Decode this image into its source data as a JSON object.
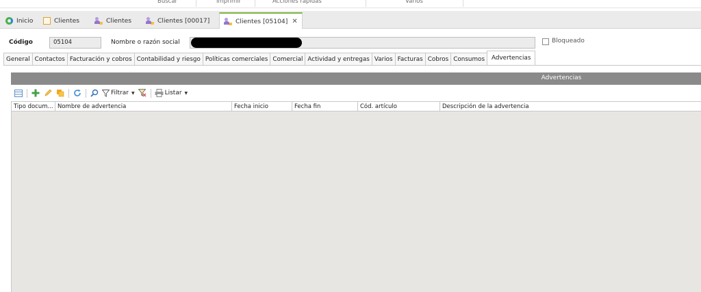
{
  "ribbon": {
    "groups": [
      "Buscar",
      "Imprimir",
      "Acciones rápidas",
      "Varios"
    ]
  },
  "doc_tabs": [
    {
      "label": "Inicio",
      "icon": "home-icon"
    },
    {
      "label": "Clientes",
      "icon": "document-icon"
    },
    {
      "label": "Clientes",
      "icon": "user-icon"
    },
    {
      "label": "Clientes [00017]",
      "icon": "user-icon"
    },
    {
      "label": "Clientes [05104]",
      "icon": "user-icon",
      "active": true,
      "closable": true
    }
  ],
  "header": {
    "codigo_label": "Código",
    "codigo_value": "05104",
    "nombre_label": "Nombre o razón social",
    "nombre_value": "",
    "bloqueado_label": "Bloqueado",
    "bloqueado_checked": false
  },
  "section_tabs": [
    "General",
    "Contactos",
    "Facturación y cobros",
    "Contabilidad y riesgo",
    "Políticas comerciales",
    "Comercial",
    "Actividad y entregas",
    "Varios",
    "Facturas",
    "Cobros",
    "Consumos",
    "Advertencias"
  ],
  "active_section_tab": "Advertencias",
  "panel": {
    "title": "Advertencias",
    "toolbar": {
      "filtrar_label": "Filtrar",
      "listar_label": "Listar"
    },
    "columns": [
      "Tipo docum...",
      "Nombre de advertencia",
      "Fecha inicio",
      "Fecha fin",
      "Cód. artículo",
      "Descripción de la advertencia"
    ],
    "rows": []
  },
  "colors": {
    "accent": "#7cb342",
    "panel_header": "#8a8a8a",
    "grid_bg": "#e8e6e3"
  }
}
